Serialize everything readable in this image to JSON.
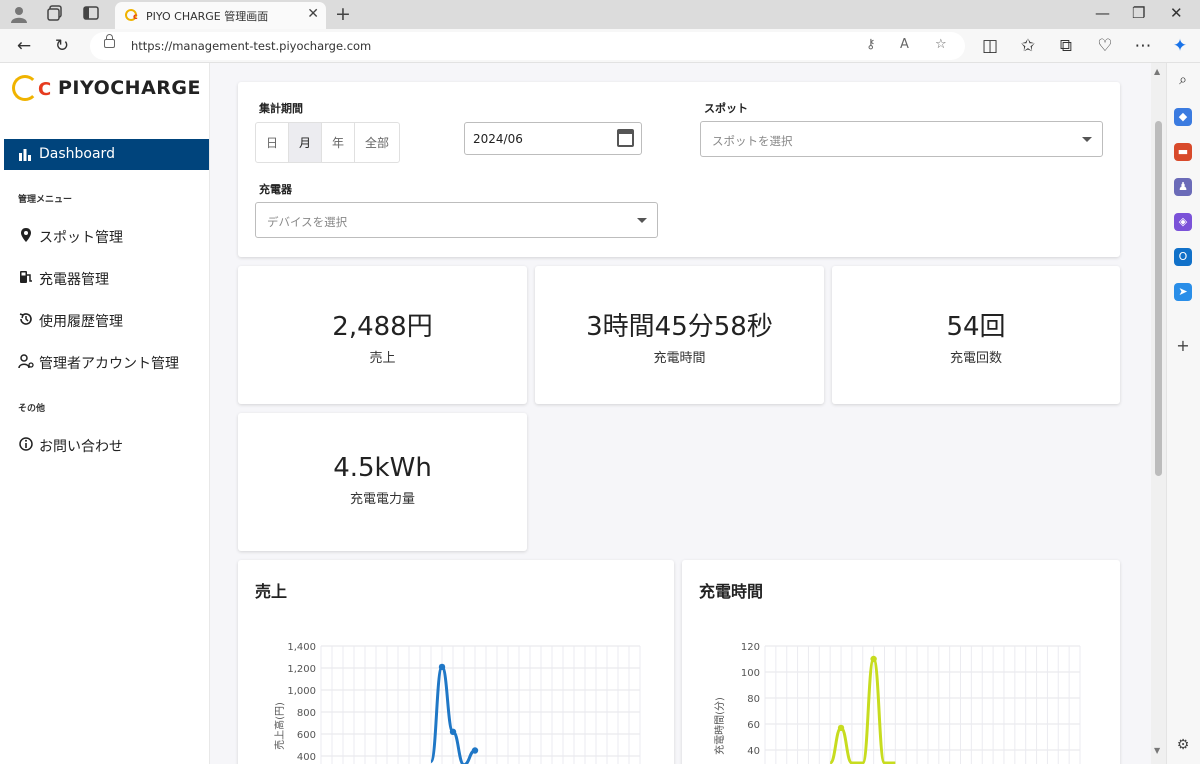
{
  "browser": {
    "tab_title": "PIYO CHARGE 管理画面",
    "url": "https://management-test.piyocharge.com"
  },
  "sidebar": {
    "logo_text": "PIYOCHARGE",
    "logo_c": "C",
    "active_item": "Dashboard",
    "section_manage": "管理メニュー",
    "items": [
      {
        "label": "スポット管理",
        "icon": "location-pin-icon"
      },
      {
        "label": "充電器管理",
        "icon": "charger-icon"
      },
      {
        "label": "使用履歴管理",
        "icon": "history-icon"
      },
      {
        "label": "管理者アカウント管理",
        "icon": "admin-account-icon"
      }
    ],
    "section_other": "その他",
    "contact": {
      "label": "お問い合わせ",
      "icon": "info-icon"
    }
  },
  "filters": {
    "period_label": "集計期間",
    "period_options": [
      "日",
      "月",
      "年",
      "全部"
    ],
    "period_selected": "月",
    "date_value": "2024/06",
    "spot_label": "スポット",
    "spot_placeholder": "スポットを選択",
    "charger_label": "充電器",
    "charger_placeholder": "デバイスを選択"
  },
  "stats": [
    {
      "value": "2,488円",
      "label": "売上"
    },
    {
      "value": "3時間45分58秒",
      "label": "充電時間"
    },
    {
      "value": "54回",
      "label": "充電回数"
    },
    {
      "value": "4.5kWh",
      "label": "充電電力量"
    }
  ],
  "colors": {
    "accent": "#00447c",
    "sales_line": "#1f77c6",
    "time_line": "#c7dc1f"
  },
  "chart_data": [
    {
      "type": "line",
      "title": "売上",
      "ylabel": "売上高(円)",
      "ylim": [
        400,
        1400
      ],
      "yticks": [
        "1,400",
        "1,200",
        "1,000",
        "800",
        "600",
        "400"
      ],
      "xlim": [
        1,
        30
      ],
      "series": [
        {
          "x": [
            11,
            12,
            13,
            14,
            15
          ],
          "values": [
            350,
            1210,
            620,
            320,
            450
          ]
        }
      ]
    },
    {
      "type": "line",
      "title": "充電時間",
      "ylabel": "充電時間(分)",
      "ylim": [
        40,
        120
      ],
      "yticks": [
        "120",
        "100",
        "80",
        "60",
        "40"
      ],
      "xlim": [
        1,
        30
      ],
      "series": [
        {
          "x": [
            7,
            8,
            9,
            10,
            11,
            12,
            13
          ],
          "values": [
            30,
            57,
            30,
            30,
            110,
            30,
            30
          ]
        }
      ]
    }
  ]
}
